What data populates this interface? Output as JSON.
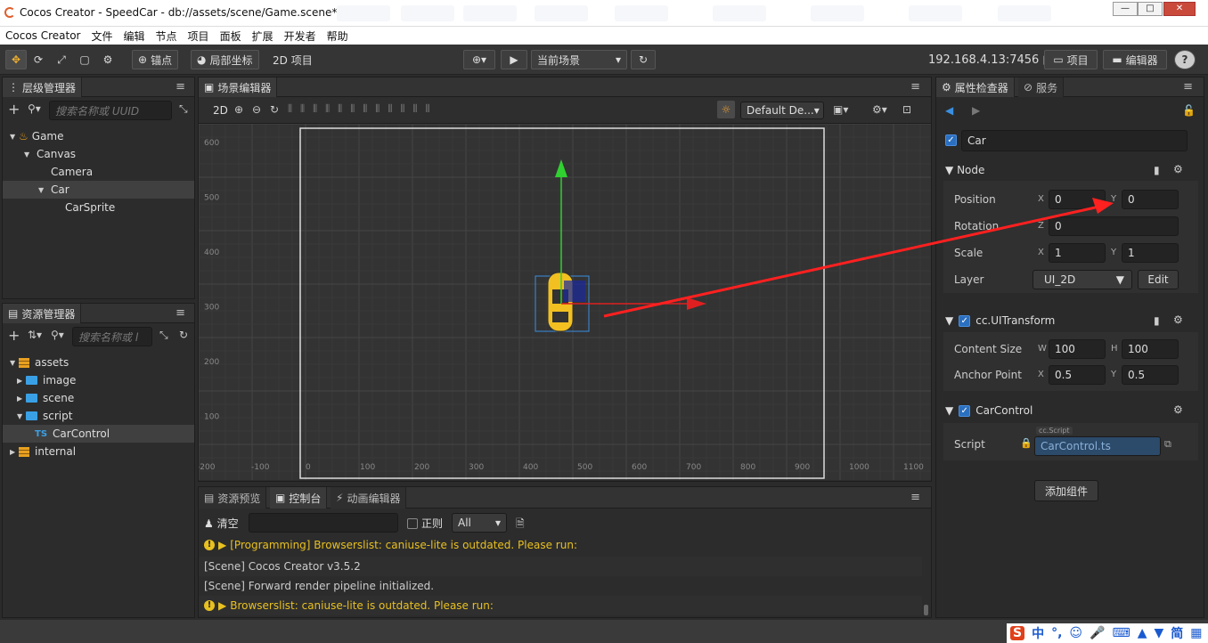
{
  "window": {
    "title": "Cocos Creator - SpeedCar - db://assets/scene/Game.scene*",
    "minimize": "—",
    "maximize": "□",
    "close": "✕"
  },
  "menu": [
    "Cocos Creator",
    "文件",
    "编辑",
    "节点",
    "项目",
    "面板",
    "扩展",
    "开发者",
    "帮助"
  ],
  "toolbar": {
    "pivot": "锚点",
    "local": "局部坐标",
    "mode2d": "2D 项目",
    "scene_select": "当前场景",
    "ip": "192.168.4.13:7456",
    "project": "项目",
    "editor": "编辑器",
    "help": "?"
  },
  "hierarchy": {
    "tab": "层级管理器",
    "search_placeholder": "搜索名称或 UUID",
    "nodes": [
      {
        "label": "Game",
        "depth": 0,
        "expanded": true
      },
      {
        "label": "Canvas",
        "depth": 1,
        "expanded": true
      },
      {
        "label": "Camera",
        "depth": 2,
        "expanded": false
      },
      {
        "label": "Car",
        "depth": 2,
        "expanded": true,
        "selected": true
      },
      {
        "label": "CarSprite",
        "depth": 3,
        "expanded": false
      }
    ]
  },
  "assets": {
    "tab": "资源管理器",
    "search_placeholder": "搜索名称或 l",
    "items": [
      {
        "label": "assets",
        "kind": "db",
        "depth": 0,
        "expanded": true
      },
      {
        "label": "image",
        "kind": "folder",
        "depth": 1,
        "expanded": false
      },
      {
        "label": "scene",
        "kind": "folder",
        "depth": 1,
        "expanded": false
      },
      {
        "label": "script",
        "kind": "folder",
        "depth": 1,
        "expanded": true
      },
      {
        "label": "CarControl",
        "kind": "ts",
        "depth": 2,
        "selected": true
      },
      {
        "label": "internal",
        "kind": "db",
        "depth": 0,
        "expanded": false
      }
    ]
  },
  "scene": {
    "tab": "场景编辑器",
    "mode": "2D",
    "layout_select": "Default De...",
    "y_ticks": [
      "600",
      "500",
      "400",
      "300",
      "200",
      "100"
    ],
    "x_ticks": [
      "-200",
      "-100",
      "0",
      "100",
      "200",
      "300",
      "400",
      "500",
      "600",
      "700",
      "800",
      "900",
      "1000",
      "1100"
    ]
  },
  "console": {
    "tabs": [
      "资源预览",
      "控制台",
      "动画编辑器"
    ],
    "clear": "清空",
    "regex": "正则",
    "level": "All",
    "logs": [
      {
        "type": "warn",
        "text": "[Programming] Browserslist: caniuse-lite is outdated. Please run:"
      },
      {
        "type": "info",
        "text": "[Scene] Cocos Creator v3.5.2"
      },
      {
        "type": "info",
        "text": "[Scene] Forward render pipeline initialized."
      },
      {
        "type": "warn",
        "text": "Browserslist: caniuse-lite is outdated. Please run:"
      }
    ]
  },
  "inspector": {
    "tab": "属性检查器",
    "tab2": "服务",
    "node_name": "Car",
    "node_section": "Node",
    "position_label": "Position",
    "pos_x": "0",
    "pos_y": "0",
    "rotation_label": "Rotation",
    "rot_z": "0",
    "scale_label": "Scale",
    "scale_x": "1",
    "scale_y": "1",
    "layer_label": "Layer",
    "layer_value": "UI_2D",
    "edit": "Edit",
    "uitransform": "cc.UITransform",
    "content_size_label": "Content Size",
    "width": "100",
    "height": "100",
    "anchor_label": "Anchor Point",
    "anchor_x": "0.5",
    "anchor_y": "0.5",
    "carcontrol": "CarControl",
    "script_label": "Script",
    "script_tag": "cc.Script",
    "script_value": "CarControl.ts",
    "add_component": "添加组件",
    "axis_x": "X",
    "axis_y": "Y",
    "axis_z": "Z",
    "axis_w": "W",
    "axis_h": "H"
  },
  "taskbar": {
    "ime_cn": "中",
    "ime_punct": "°,",
    "ime_simp": "简"
  },
  "colors": {
    "accent": "#f0b030",
    "select_blue": "#2a6fc0",
    "warn": "#e8c020",
    "annotation": "#ff2020"
  }
}
